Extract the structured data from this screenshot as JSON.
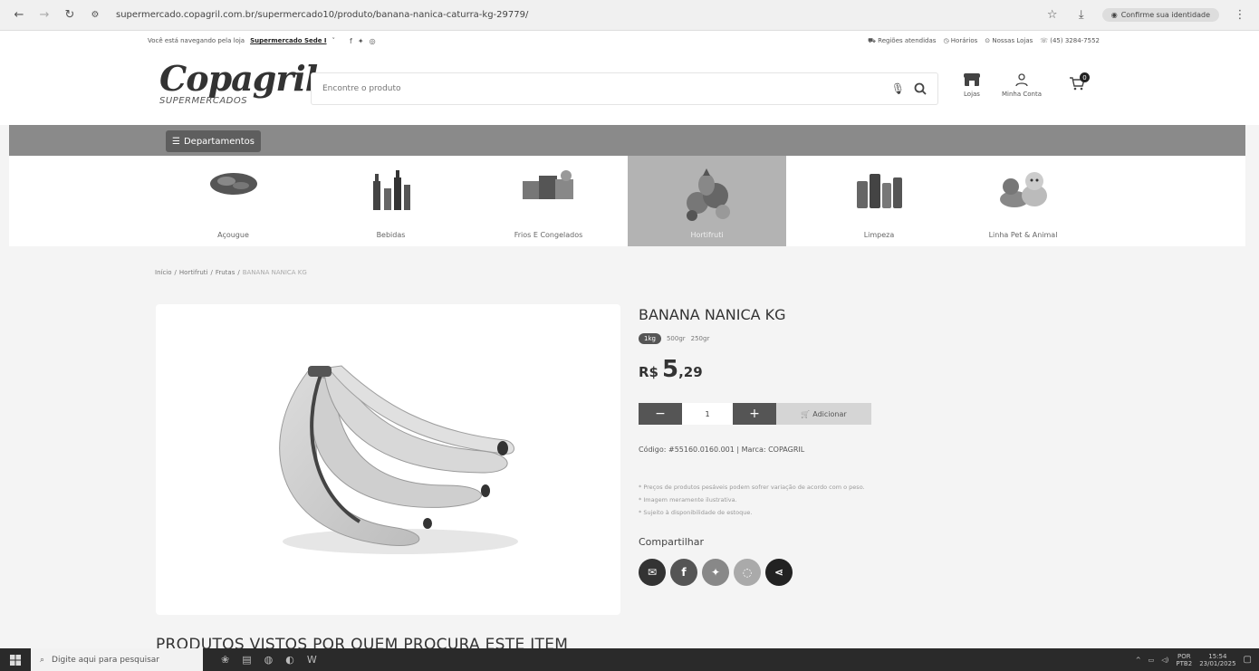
{
  "browser": {
    "url": "supermercado.copagril.com.br/supermercado10/produto/banana-nanica-caturra-kg-29779/",
    "identity_label": "Confirme sua identidade"
  },
  "topbar": {
    "store_prefix": "Você está navegando pela loja",
    "store_name": "Supermercado Sede I",
    "regions": "Regiões atendidas",
    "hours": "Horários",
    "stores": "Nossas Lojas",
    "phone": "(45) 3284-7552"
  },
  "header": {
    "logo_main": "Copagril",
    "logo_sub": "SUPERMERCADOS",
    "search_placeholder": "Encontre o produto",
    "stores_label": "Lojas",
    "account_label": "Minha Conta",
    "cart_count": "0"
  },
  "deptbar": {
    "label": "Departamentos"
  },
  "categories": [
    {
      "label": "Açougue",
      "icon": "meat-icon"
    },
    {
      "label": "Bebidas",
      "icon": "bottles-icon"
    },
    {
      "label": "Frios E Congelados",
      "icon": "cold-cuts-icon"
    },
    {
      "label": "Hortifruti",
      "icon": "produce-icon"
    },
    {
      "label": "Limpeza",
      "icon": "cleaning-icon"
    },
    {
      "label": "Linha Pet & Animal",
      "icon": "pets-icon"
    }
  ],
  "breadcrumb": {
    "home": "Início",
    "cat": "Hortifruti",
    "sub": "Frutas",
    "current": "BANANA NANICA KG"
  },
  "product": {
    "title": "BANANA NANICA KG",
    "sizes": [
      "1kg",
      "500gr",
      "250gr"
    ],
    "price_currency": "R$",
    "price_int": "5",
    "price_dec": ",29",
    "qty": "1",
    "minus": "−",
    "plus": "+",
    "add_label": "Adicionar",
    "code_line": "Código: #55160.0160.001 | Marca: COPAGRIL",
    "notes": [
      "* Preços de produtos pesáveis podem sofrer variação de acordo com o peso.",
      "* Imagem meramente ilustrativa.",
      "* Sujeito à disponibilidade de estoque."
    ],
    "share_label": "Compartilhar"
  },
  "section_title": "PRODUTOS VISTOS POR QUEM PROCURA ESTE ITEM",
  "taskbar": {
    "search_placeholder": "Digite aqui para pesquisar",
    "lang": "POR",
    "lang2": "PTB2",
    "time": "15:54",
    "date": "23/01/2025"
  }
}
